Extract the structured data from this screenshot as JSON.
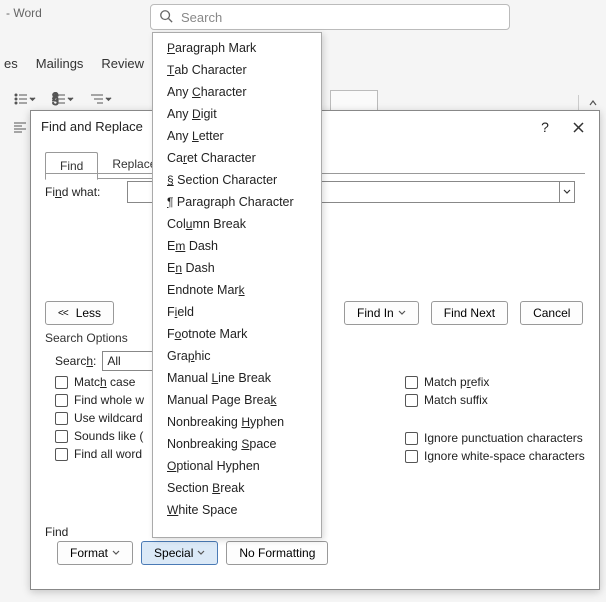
{
  "titlebar": {
    "suffix": "- Word"
  },
  "search": {
    "placeholder": "Search"
  },
  "ribbon": {
    "tabs": [
      "es",
      "Mailings",
      "Review"
    ]
  },
  "dialog": {
    "title": "Find and Replace",
    "help": "?",
    "tabs": {
      "find": "Find",
      "replace": "Replace"
    },
    "find_what_prefix": "Fi",
    "find_what_u": "n",
    "find_what_suffix": "d what:",
    "less": "Less",
    "find_in": "Find In",
    "find_next": "Find Next",
    "cancel": "Cancel",
    "search_options": "Search Options",
    "search_label_pre": "Searc",
    "search_label_u": "h",
    "search_label_post": ":",
    "search_value": "All",
    "checks_left": [
      {
        "u": "",
        "pre": "Matc",
        "mid": "h",
        "post": " case"
      },
      {
        "u": "",
        "pre": "Find whole w",
        "mid": "",
        "post": ""
      },
      {
        "u": "",
        "pre": "Use wildcard",
        "mid": "",
        "post": ""
      },
      {
        "u": "",
        "pre": "Sounds like (",
        "mid": "",
        "post": ""
      },
      {
        "u": "",
        "pre": "Find all word",
        "mid": "",
        "post": ""
      }
    ],
    "checks_right1": [
      {
        "pre": "Match p",
        "u": "r",
        "post": "efix"
      },
      {
        "pre": "Match s",
        "u": "",
        "post": "uffix"
      }
    ],
    "checks_right2": [
      {
        "pre": "Ignore punctuation characters",
        "u": "",
        "post": ""
      },
      {
        "pre": "Ignore white-space characters",
        "u": "",
        "post": ""
      }
    ],
    "find_section": "Find",
    "format": "Format",
    "special": "Special",
    "no_formatting": "No Formatting"
  },
  "menu": {
    "items": [
      {
        "u": "P",
        "rest": "aragraph Mark"
      },
      {
        "u": "T",
        "rest": "ab Character"
      },
      {
        "pre": "Any ",
        "u": "C",
        "rest": "haracter"
      },
      {
        "pre": "Any ",
        "u": "D",
        "rest": "igit"
      },
      {
        "pre": "Any ",
        "u": "L",
        "rest": "etter"
      },
      {
        "pre": "Ca",
        "u": "r",
        "rest": "et Character"
      },
      {
        "u": "§",
        "rest": " Section Character"
      },
      {
        "u": "¶",
        "rest": " Paragraph Character"
      },
      {
        "pre": "Col",
        "u": "u",
        "rest": "mn Break"
      },
      {
        "pre": "E",
        "u": "m",
        "rest": " Dash"
      },
      {
        "pre": "E",
        "u": "n",
        "rest": " Dash"
      },
      {
        "pre": "Endnote Mar",
        "u": "k",
        "rest": ""
      },
      {
        "pre": "F",
        "u": "i",
        "rest": "eld"
      },
      {
        "pre": "F",
        "u": "o",
        "rest": "otnote Mark"
      },
      {
        "pre": "Gra",
        "u": "p",
        "rest": "hic"
      },
      {
        "pre": "Manual ",
        "u": "L",
        "rest": "ine Break"
      },
      {
        "pre": "Manual Page Brea",
        "u": "k",
        "rest": ""
      },
      {
        "pre": "Nonbreaking ",
        "u": "H",
        "rest": "yphen"
      },
      {
        "pre": "Nonbreaking ",
        "u": "S",
        "rest": "pace"
      },
      {
        "u": "O",
        "rest": "ptional Hyphen"
      },
      {
        "pre": "Section ",
        "u": "B",
        "rest": "reak"
      },
      {
        "u": "W",
        "rest": "hite Space"
      }
    ]
  }
}
